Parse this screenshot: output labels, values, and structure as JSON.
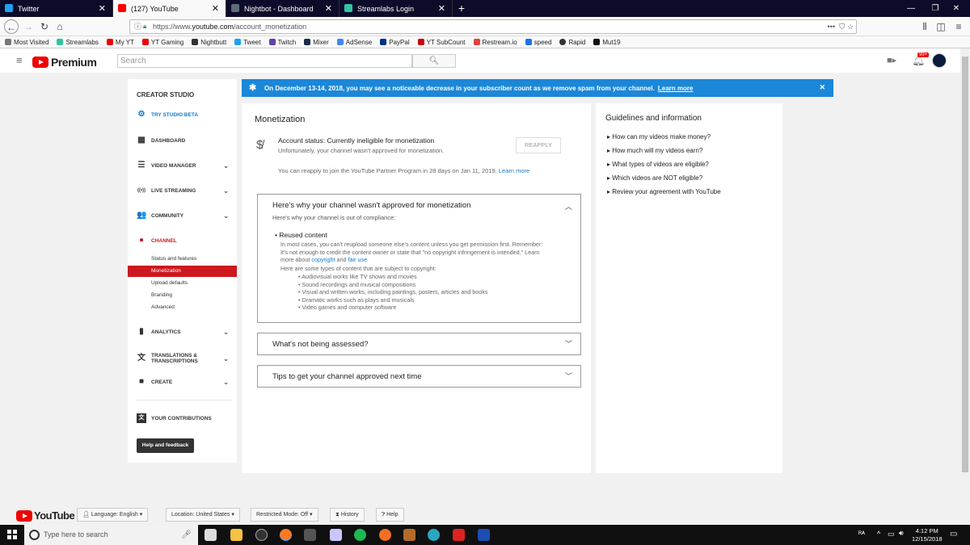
{
  "browser": {
    "tabs": [
      {
        "label": "Twitter",
        "color": "#1da1f2"
      },
      {
        "label": "(127) YouTube",
        "color": "#ff0000"
      },
      {
        "label": "Nightbot - Dashboard",
        "color": "#5f6b7a"
      },
      {
        "label": "Streamlabs Login",
        "color": "#31c3a2"
      }
    ],
    "new_tab": "+",
    "url_prefix": "https://www.",
    "url_host": "youtube.com",
    "url_path": "/account_monetization",
    "bookmarks": [
      {
        "label": "Most Visited",
        "color": "#777"
      },
      {
        "label": "Streamlabs",
        "color": "#31c3a2"
      },
      {
        "label": "My YT",
        "color": "#e00"
      },
      {
        "label": "YT Gaming",
        "color": "#e00"
      },
      {
        "label": "Nightbutt",
        "color": "#333"
      },
      {
        "label": "Tweet",
        "color": "#1da1f2"
      },
      {
        "label": "Twitch",
        "color": "#6441a4"
      },
      {
        "label": "Mixer",
        "color": "#1c2a4a"
      },
      {
        "label": "AdSense",
        "color": "#4285f4"
      },
      {
        "label": "PayPal",
        "color": "#003087"
      },
      {
        "label": "YT SubCount",
        "color": "#c00"
      },
      {
        "label": "Restream.io",
        "color": "#e0433a"
      },
      {
        "label": "speed",
        "color": "#1a73e8"
      },
      {
        "label": "Rapid",
        "color": "#333"
      },
      {
        "label": "Mut19",
        "color": "#111"
      }
    ]
  },
  "yt": {
    "logo": "Premium",
    "search_placeholder": "Search",
    "notif_count": "99+"
  },
  "sidebar": {
    "heading": "CREATOR STUDIO",
    "try_beta": "TRY STUDIO BETA",
    "items": [
      {
        "label": "DASHBOARD",
        "icon": "▦"
      },
      {
        "label": "VIDEO MANAGER",
        "icon": "☰"
      },
      {
        "label": "LIVE STREAMING",
        "icon": "((•))"
      },
      {
        "label": "COMMUNITY",
        "icon": "👥"
      },
      {
        "label": "CHANNEL",
        "icon": "●"
      }
    ],
    "channel_sub": [
      {
        "label": "Status and features"
      },
      {
        "label": "Monetization"
      },
      {
        "label": "Upload defaults"
      },
      {
        "label": "Branding"
      },
      {
        "label": "Advanced"
      }
    ],
    "lower": [
      {
        "label": "ANALYTICS",
        "icon": "▮"
      },
      {
        "label1": "TRANSLATIONS &",
        "label2": "TRANSCRIPTIONS",
        "icon": "文"
      },
      {
        "label": "CREATE",
        "icon": "■"
      }
    ],
    "contrib": "YOUR CONTRIBUTIONS",
    "help": "Help and feedback"
  },
  "banner": {
    "text": "On December 13-14, 2018, you may see a noticeable decrease in your subscriber count as we remove spam from your channel.",
    "link": "Learn more",
    "color": "#1b87d8"
  },
  "main": {
    "title": "Monetization",
    "status": "Account status: Currently ineligible for monetization",
    "status_sub": "Unfortunately, your channel wasn't approved for monetization.",
    "reapply": "REAPPLY",
    "note": "You can reapply to join the YouTube Partner Program in 28 days on Jan 11, 2019.",
    "note_link": "Learn more",
    "panel1": {
      "title": "Here's why your channel wasn't approved for monetization",
      "sub": "Here's why your channel is out of compliance:",
      "reused": "Reused content",
      "p1": "In most cases, you can't reupload someone else's content unless you get permission first. Remember:",
      "p2": "It's not enough to credit the content owner or state that \"no copyright infringement is intended.\" Learn",
      "p3_pre": "more about",
      "copyright": "copyright",
      "and": "and",
      "fair_use": "fair use",
      "types_intro": "Here are some types of content that are subject to copyright:",
      "types": [
        "Audiovisual works like TV shows and movies",
        "Sound recordings and musical compositions",
        "Visual and written works, including paintings, posters, articles and books",
        "Dramatic works such as plays and musicals",
        "Video games and computer software"
      ]
    },
    "panel2": "What's not being assessed?",
    "panel3": "Tips to get your channel approved next time"
  },
  "guide": {
    "title": "Guidelines and information",
    "questions": [
      "How can my videos make money?",
      "How much will my videos earn?",
      "What types of videos are eligible?",
      "Which videos are NOT eligible?",
      "Review your agreement with YouTube"
    ]
  },
  "footer": {
    "logo": "YouTube",
    "language": "Language: English",
    "location": "Location: United States",
    "restricted": "Restricted Mode: Off",
    "history": "History",
    "help": "Help"
  },
  "taskbar": {
    "search": "Type here to search",
    "time": "4:12 PM",
    "date": "12/15/2018"
  }
}
